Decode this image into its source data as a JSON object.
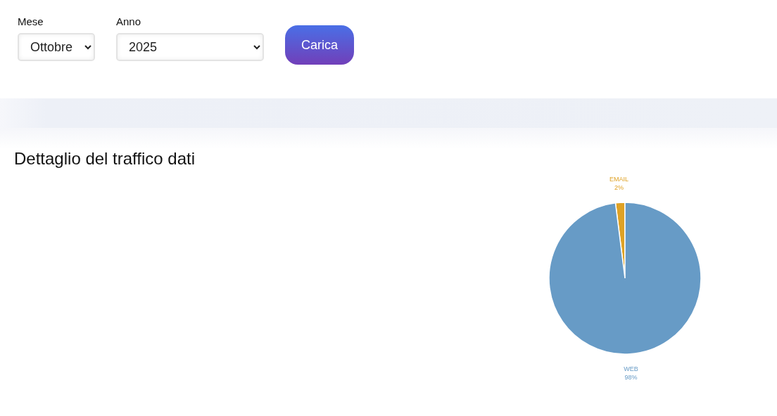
{
  "filters": [
    {
      "label": "Mese",
      "value": "Ottobre"
    },
    {
      "label": "Anno",
      "value": "2025"
    }
  ],
  "load_button": "Carica",
  "section": {
    "title": "Dettaglio del traffico dati",
    "chart_data": {
      "type": "pie",
      "categories": [
        "EMAIL",
        "WEB"
      ],
      "values": [
        2,
        98
      ],
      "value_labels": [
        "2%",
        "98%"
      ],
      "colors": [
        "#dfa226",
        "#679bc6"
      ]
    }
  }
}
